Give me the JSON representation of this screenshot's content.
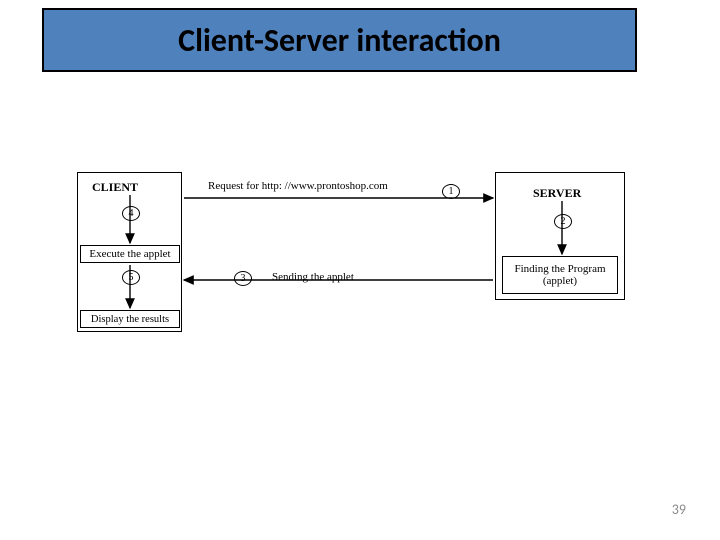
{
  "slide": {
    "title": "Client-Server interaction",
    "page_number": "39"
  },
  "diagram": {
    "client": {
      "title": "CLIENT",
      "boxes": {
        "execute": "Execute the applet",
        "display": "Display the results"
      }
    },
    "server": {
      "title": "SERVER",
      "boxes": {
        "finding": "Finding the Program (applet)"
      }
    },
    "steps": {
      "s1": "1",
      "s2": "2",
      "s3": "3",
      "s4": "4",
      "s5": "5"
    },
    "labels": {
      "request": "Request for http: //www.prontoshop.com",
      "sending": "Sending the applet"
    }
  }
}
